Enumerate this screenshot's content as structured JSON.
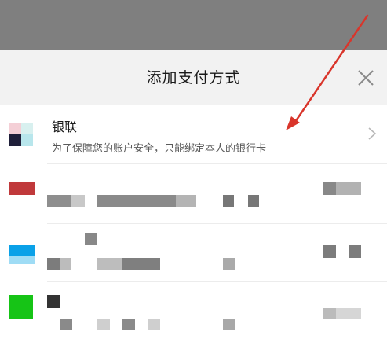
{
  "sheet": {
    "title": "添加支付方式"
  },
  "unionpay_row": {
    "name": "银联",
    "description": "为了保障您的账户安全，只能绑定本人的银行卡"
  },
  "colors": {
    "annotation_arrow": "#d9352b",
    "bank_red": "#c0393b",
    "bank_blue": "#0aa1e8",
    "bank_green": "#16c416"
  },
  "icons": {
    "close": "close-icon",
    "chevron": "chevron-right-icon"
  }
}
